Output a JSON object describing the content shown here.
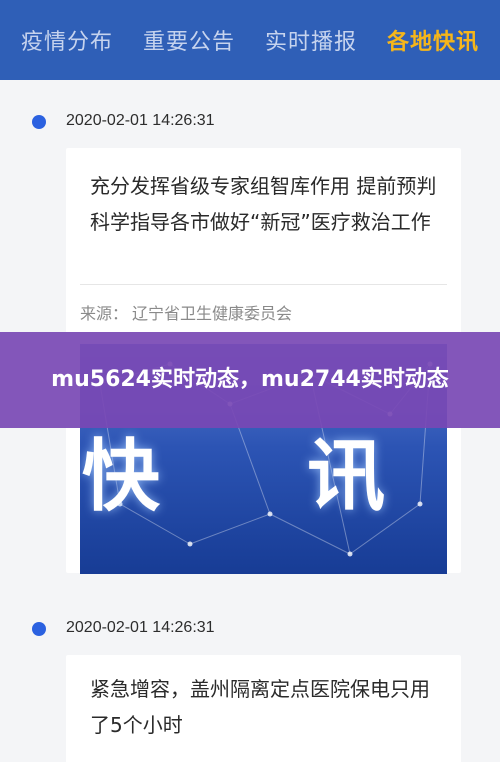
{
  "nav": {
    "tabs": [
      {
        "label": "疫情分布"
      },
      {
        "label": "重要公告"
      },
      {
        "label": "实时播报"
      },
      {
        "label": "各地快讯"
      }
    ],
    "active_color": "#f6b61a",
    "background": "#2f5fb7"
  },
  "feed": {
    "items": [
      {
        "timestamp": "2020-02-01 14:26:31",
        "title": "充分发挥省级专家组智库作用 提前预判 科学指导各市做好“新冠”医疗救治工作",
        "source_label": "来源：",
        "source_name": "辽宁省卫生健康委员会",
        "image_text": "快 讯",
        "dot_color": "#2b61e0"
      },
      {
        "timestamp": "2020-02-01 14:26:31",
        "title": "紧急增容，盖州隔离定点医院保电只用了5个小时",
        "dot_color": "#2b61e0"
      }
    ]
  },
  "overlay": {
    "headline": "mu5624实时动态，mu2744实时动态",
    "color": "#7848b4"
  }
}
